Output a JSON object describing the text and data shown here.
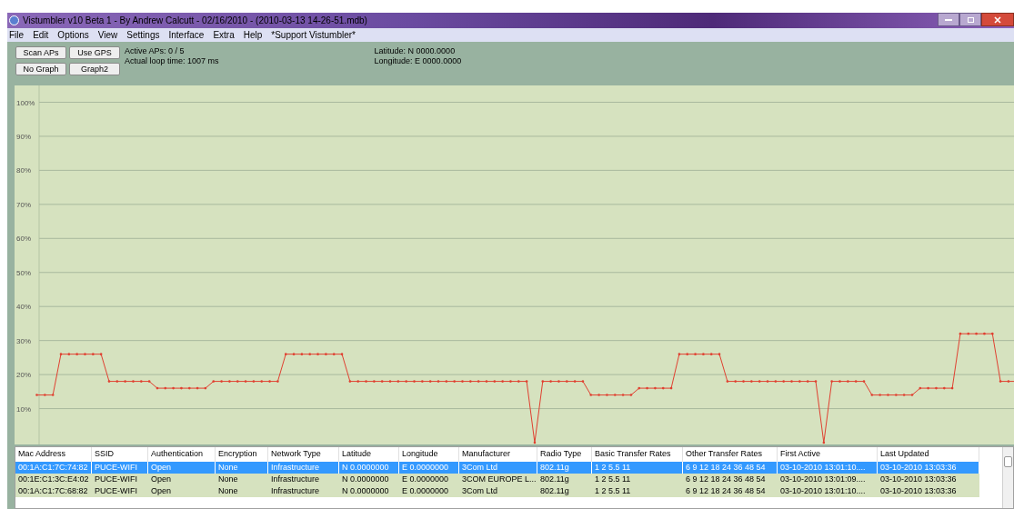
{
  "window": {
    "title": "Vistumbler v10 Beta 1 - By Andrew Calcutt - 02/16/2010 - (2010-03-13 14-26-51.mdb)"
  },
  "menu": [
    {
      "label": "File"
    },
    {
      "label": "Edit"
    },
    {
      "label": "Options"
    },
    {
      "label": "View"
    },
    {
      "label": "Settings"
    },
    {
      "label": "Interface"
    },
    {
      "label": "Extra"
    },
    {
      "label": "Help"
    },
    {
      "label": "*Support Vistumbler*"
    }
  ],
  "toolbar": {
    "buttons": [
      {
        "label": "Scan APs"
      },
      {
        "label": "Use GPS"
      },
      {
        "label": "No Graph"
      },
      {
        "label": "Graph2"
      }
    ],
    "status": [
      "Active APs: 0 / 5",
      "Actual loop time: 1007 ms"
    ],
    "gps": [
      "Latitude: N 0000.0000",
      "Longitude: E 0000.0000"
    ]
  },
  "graph": {
    "chart_data": {
      "type": "line",
      "grid": true,
      "ylim": [
        0,
        100
      ],
      "yticks": [
        {
          "value": 10,
          "label": "10%"
        },
        {
          "value": 20,
          "label": "20%"
        },
        {
          "value": 30,
          "label": "30%"
        },
        {
          "value": 40,
          "label": "40%"
        },
        {
          "value": 50,
          "label": "50%"
        },
        {
          "value": 60,
          "label": "60%"
        },
        {
          "value": 70,
          "label": "70%"
        },
        {
          "value": 80,
          "label": "80%"
        },
        {
          "value": 90,
          "label": "90%"
        },
        {
          "value": 100,
          "label": "100%"
        }
      ],
      "series": [
        {
          "color": "#e04030",
          "values": [
            14,
            14,
            14,
            26,
            26,
            26,
            26,
            26,
            26,
            18,
            18,
            18,
            18,
            18,
            18,
            16,
            16,
            16,
            16,
            16,
            16,
            16,
            18,
            18,
            18,
            18,
            18,
            18,
            18,
            18,
            18,
            26,
            26,
            26,
            26,
            26,
            26,
            26,
            26,
            18,
            18,
            18,
            18,
            18,
            18,
            18,
            18,
            18,
            18,
            18,
            18,
            18,
            18,
            18,
            18,
            18,
            18,
            18,
            18,
            18,
            18,
            18,
            0,
            18,
            18,
            18,
            18,
            18,
            18,
            14,
            14,
            14,
            14,
            14,
            14,
            16,
            16,
            16,
            16,
            16,
            26,
            26,
            26,
            26,
            26,
            26,
            18,
            18,
            18,
            18,
            18,
            18,
            18,
            18,
            18,
            18,
            18,
            18,
            0,
            18,
            18,
            18,
            18,
            18,
            14,
            14,
            14,
            14,
            14,
            14,
            16,
            16,
            16,
            16,
            16,
            32,
            32,
            32,
            32,
            32,
            18,
            18,
            18
          ]
        }
      ]
    }
  },
  "table": {
    "columns": [
      "Mac Address",
      "SSID",
      "Authentication",
      "Encryption",
      "Network Type",
      "Latitude",
      "Longitude",
      "Manufacturer",
      "Radio Type",
      "Basic Transfer Rates",
      "Other Transfer Rates",
      "First Active",
      "Last Updated"
    ],
    "rows": [
      {
        "selected": true,
        "cells": [
          "00:1A:C1:7C:74:82",
          "PUCE-WIFI",
          "Open",
          "None",
          "Infrastructure",
          "N 0.0000000",
          "E 0.0000000",
          "3Com Ltd",
          "802.11g",
          "1 2 5.5 11",
          "6 9 12 18 24 36 48 54",
          "03-10-2010 13:01:10....",
          "03-10-2010 13:03:36"
        ]
      },
      {
        "selected": false,
        "cells": [
          "00:1E:C1:3C:E4:02",
          "PUCE-WIFI",
          "Open",
          "None",
          "Infrastructure",
          "N 0.0000000",
          "E 0.0000000",
          "3COM EUROPE L...",
          "802.11g",
          "1 2 5.5 11",
          "6 9 12 18 24 36 48 54",
          "03-10-2010 13:01:09....",
          "03-10-2010 13:03:36"
        ]
      },
      {
        "selected": false,
        "cells": [
          "00:1A:C1:7C:68:82",
          "PUCE-WIFI",
          "Open",
          "None",
          "Infrastructure",
          "N 0.0000000",
          "E 0.0000000",
          "3Com Ltd",
          "802.11g",
          "1 2 5.5 11",
          "6 9 12 18 24 36 48 54",
          "03-10-2010 13:01:10....",
          "03-10-2010 13:03:36"
        ]
      }
    ]
  }
}
